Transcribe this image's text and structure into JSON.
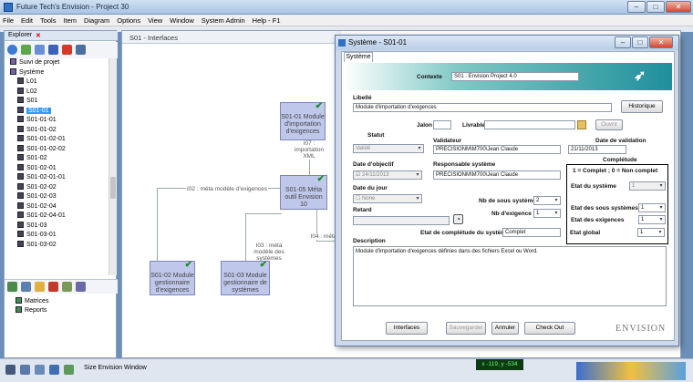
{
  "window": {
    "title": "Future Tech's Envision - Project 30"
  },
  "menu": [
    "File",
    "Edit",
    "Tools",
    "Item",
    "Diagram",
    "Options",
    "View",
    "Window",
    "System Admin",
    "Help - F1"
  ],
  "explorer": {
    "tab_label": "Explorer",
    "tree": [
      {
        "label": "Suivi de projet",
        "indent": 0
      },
      {
        "label": "Système",
        "indent": 0
      },
      {
        "label": "L01",
        "indent": 1
      },
      {
        "label": "L02",
        "indent": 1
      },
      {
        "label": "S01",
        "indent": 1
      },
      {
        "label": "S01-01",
        "indent": 1,
        "selected": true
      },
      {
        "label": "S01-01-01",
        "indent": 1
      },
      {
        "label": "S01-01-02",
        "indent": 1
      },
      {
        "label": "S01-01-02-01",
        "indent": 1
      },
      {
        "label": "S01-01-02-02",
        "indent": 1
      },
      {
        "label": "S01-02",
        "indent": 1
      },
      {
        "label": "S01-02-01",
        "indent": 1
      },
      {
        "label": "S01-02-01-01",
        "indent": 1
      },
      {
        "label": "S01-02-02",
        "indent": 1
      },
      {
        "label": "S01-02-03",
        "indent": 1
      },
      {
        "label": "S01-02-04",
        "indent": 1
      },
      {
        "label": "S01-02-04-01",
        "indent": 1
      },
      {
        "label": "S01-03",
        "indent": 1
      },
      {
        "label": "S01-03-01",
        "indent": 1
      },
      {
        "label": "S01-03-02",
        "indent": 1
      }
    ],
    "tree2": [
      {
        "label": "Matrices"
      },
      {
        "label": "Reports"
      }
    ]
  },
  "canvas": {
    "tab_label": "S01 - Interfaces",
    "boxes": [
      {
        "label": "S01-01 Module d'importation d'exigences"
      },
      {
        "label": "S01-05 Méta outil Envision 10"
      },
      {
        "label": "S01-02 Module gestionnaire d'exigences"
      },
      {
        "label": "S01-03 Module gestionnaire de systèmes"
      }
    ],
    "connectors": [
      {
        "label": "I07 : importation XML"
      },
      {
        "label": "I02 : méta modèle d'exigences"
      },
      {
        "label": "I03 : méta modèle des systèmes"
      },
      {
        "label": "I04 : méta"
      }
    ]
  },
  "dialog": {
    "title": "Système - S01-01",
    "tab": "Système",
    "contexte_label": "Contexte",
    "contexte_value": "S01 : Envision Project 4.0",
    "libelle_label": "Libellé",
    "libelle_value": "Module d'importation d'exigences",
    "historique": "Historique",
    "jalon_label": "Jalon",
    "livrable_label": "Livrable",
    "ouvrir": "Ouvrir",
    "statut_label": "Statut",
    "statut_value": "Validé",
    "validateur_label": "Validateur",
    "validateur_value": "PRECISIONM\\M700\\Jean Claude",
    "date_validation_label": "Date de validation",
    "date_validation_value": "21/11/2013",
    "date_objectif_label": "Date d'objectif",
    "date_objectif_value": "24/11/2013",
    "responsable_label": "Responsable système",
    "responsable_value": "PRECISIONM\\M700\\Jean Claude",
    "completude_label": "Complétude",
    "completude_note": "1 = Complet ; 0 = Non complet",
    "etat_systeme_label": "Etat du système",
    "etat_systeme_value": "1",
    "date_jour_label": "Date du jour",
    "date_jour_value": "None",
    "nb_sous_label": "Nb de sous système",
    "nb_sous_value": "2",
    "etat_sous_label": "Etat des sous systèmes",
    "etat_sous_value": "1",
    "nb_exigence_label": "Nb d'exigence",
    "nb_exigence_value": "1",
    "etat_exigences_label": "Etat des exigences",
    "etat_exigences_value": "1",
    "retard_label": "Retard",
    "etat_completude_label": "Etat de complétude du système",
    "etat_completude_value": "Complet",
    "etat_global_label": "Etat global",
    "etat_global_value": "1",
    "description_label": "Description",
    "description_value": "Module d'importation d'exigences définies dans des fichiers Excel ou Word.",
    "btn_interfaces": "Interfaces",
    "btn_sauvegarder": "Sauvegarder",
    "btn_annuler": "Annuler",
    "btn_checkout": "Check Out",
    "brand": "ENVISION"
  },
  "status": {
    "text": "Size Envision Window",
    "coord": "x -119, y -534"
  }
}
